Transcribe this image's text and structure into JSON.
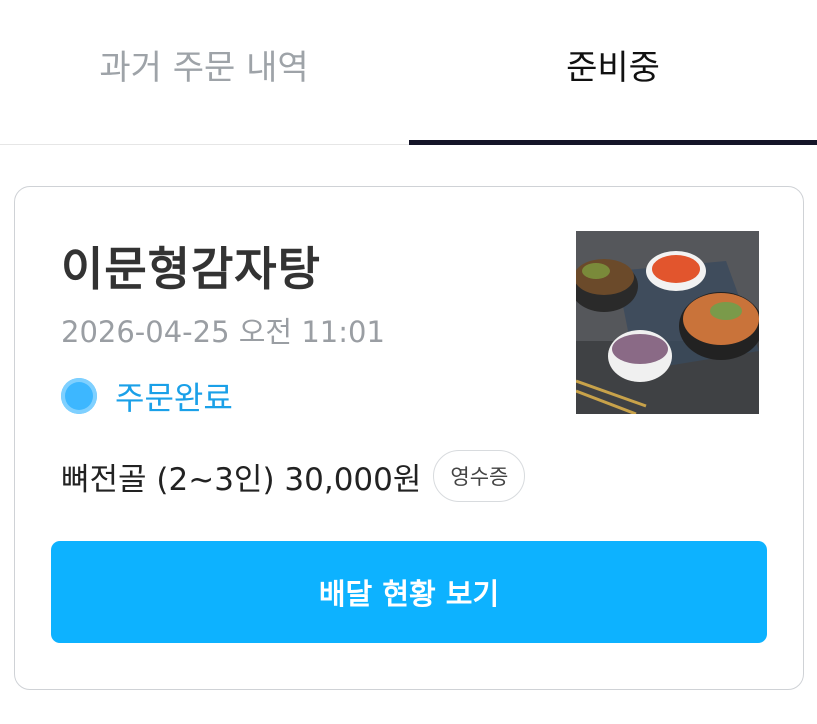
{
  "tabs": [
    {
      "label": "과거 주문 내역",
      "active": false
    },
    {
      "label": "준비중",
      "active": true
    }
  ],
  "order": {
    "store_name": "이문형감자탕",
    "datetime": "2026-04-25 오전 11:01",
    "status": "주문완료",
    "item_summary": "뼈전골 (2~3인) 30,000원",
    "receipt_label": "영수증",
    "delivery_button_label": "배달 현황 보기",
    "thumbnail_icon": "food-photo-icon"
  },
  "colors": {
    "accent": "#0db2ff",
    "status_text": "#1aa0e8",
    "status_dot": "#3db7ff",
    "active_tab_underline": "#141428",
    "inactive_tab_text": "#9ea3a8"
  }
}
